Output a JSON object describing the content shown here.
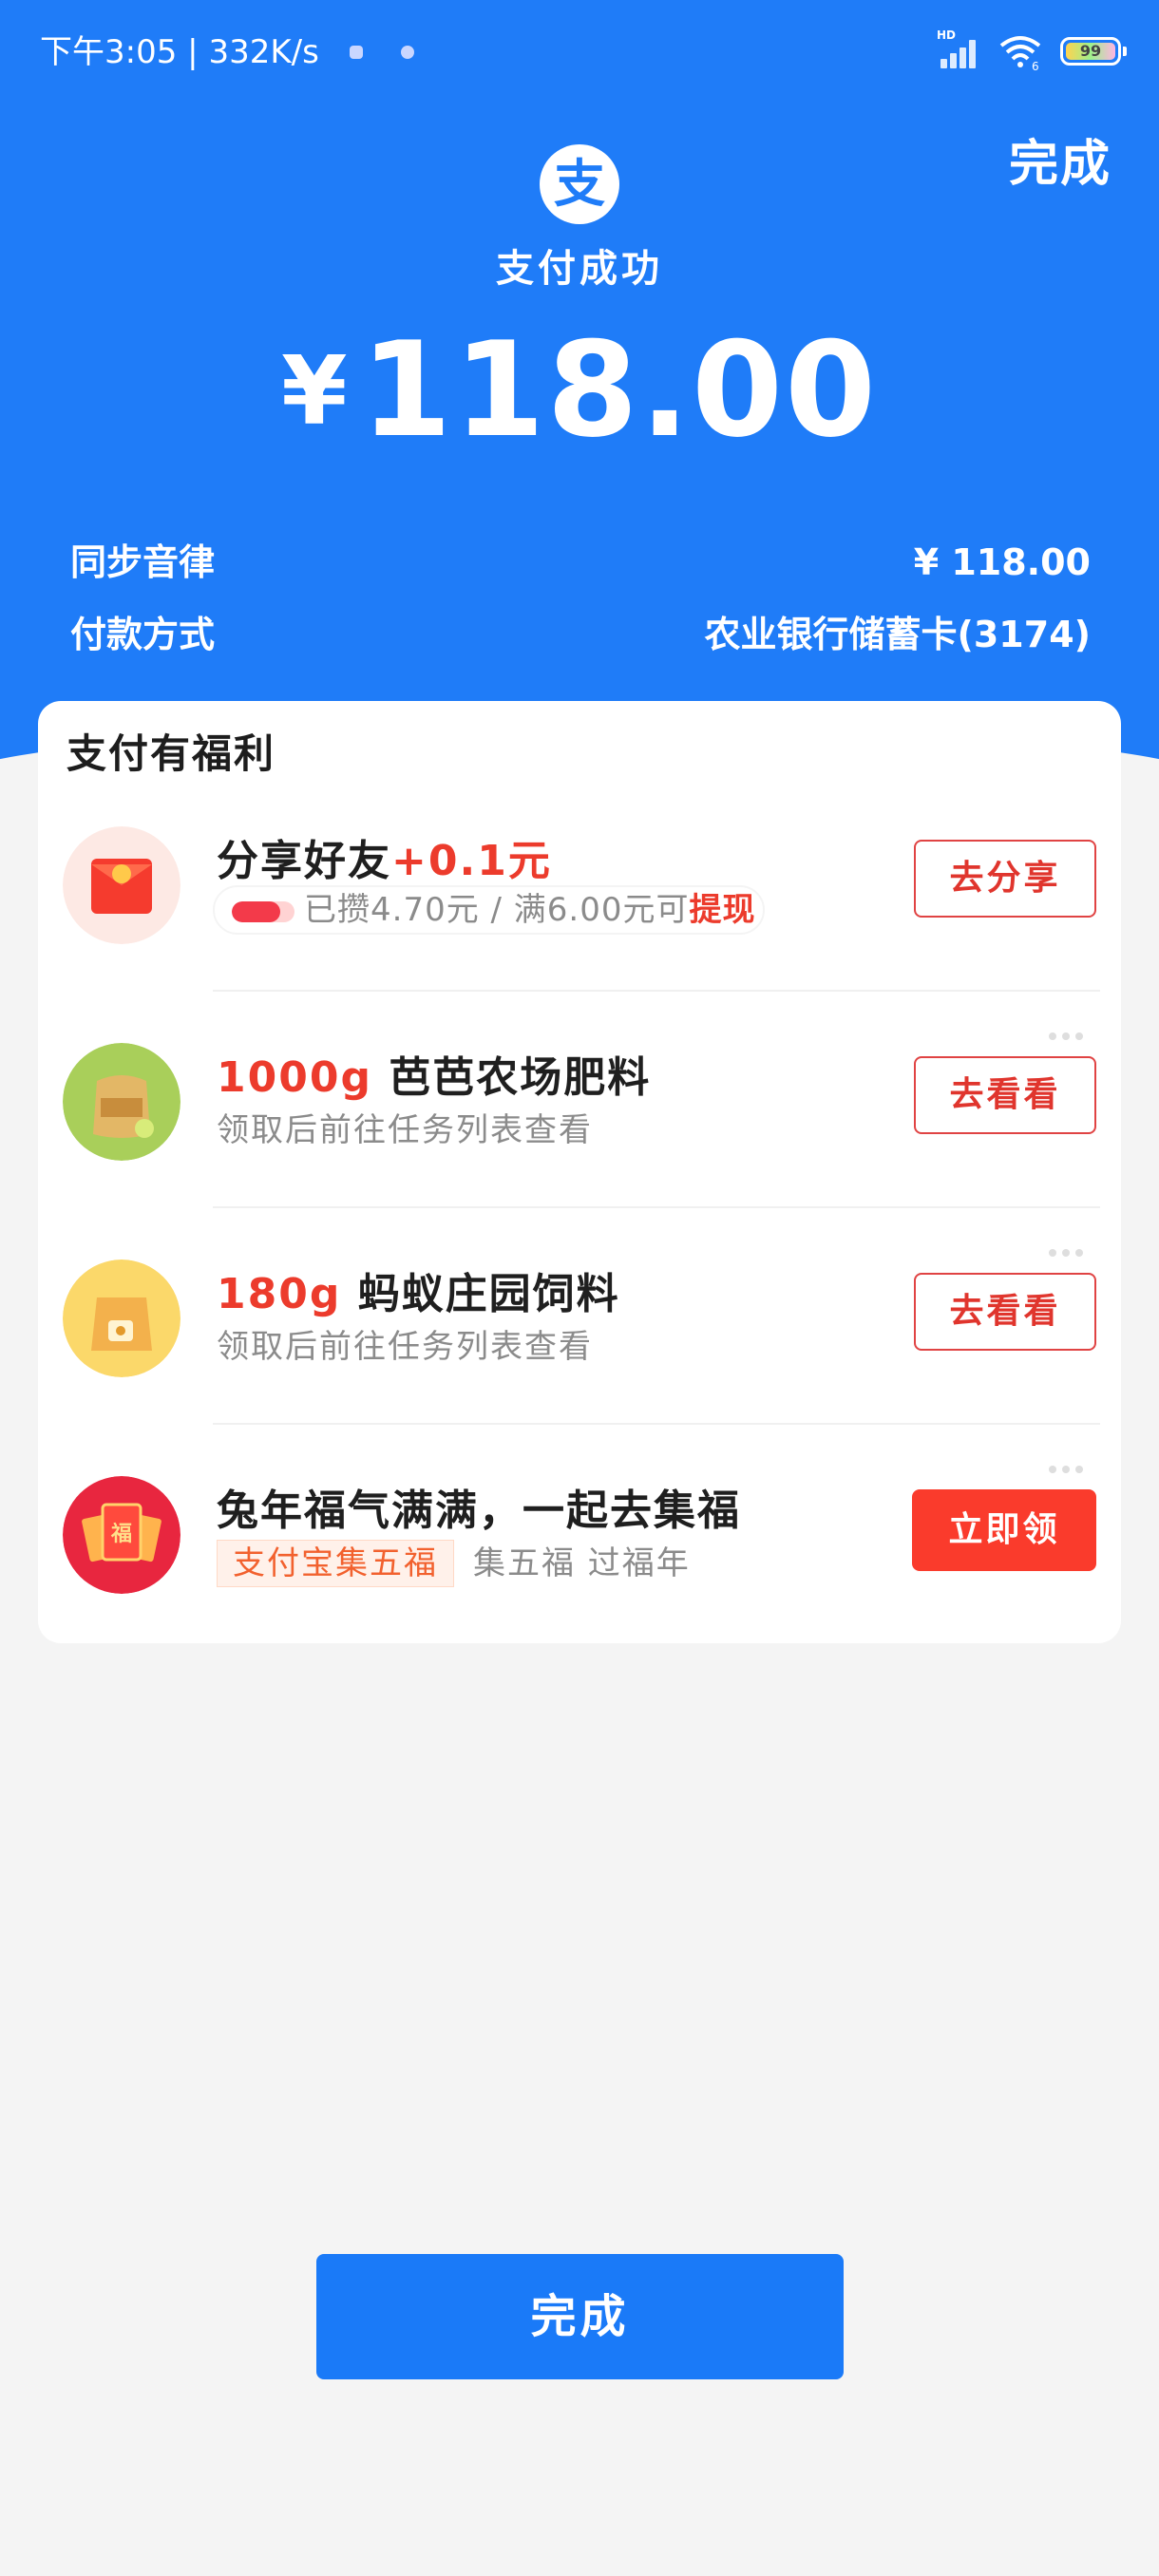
{
  "status_bar": {
    "time": "下午3:05",
    "speed": "332K/s",
    "signal_label": "HD",
    "wifi_label": "6",
    "battery": "99"
  },
  "header": {
    "done_label": "完成",
    "logo_char": "支",
    "status_text": "支付成功",
    "currency": "¥",
    "amount": "118.00"
  },
  "info": [
    {
      "key": "同步音律",
      "value": "¥ 118.00"
    },
    {
      "key": "付款方式",
      "value": "农业银行储蓄卡(3174)"
    }
  ],
  "benefits": {
    "title": "支付有福利",
    "share": {
      "title": "分享好友",
      "bonus": "+0.1元",
      "progress_text": "已攒4.70元 / 满6.00元可",
      "progress_action": "提现",
      "progress_fraction": 0.78,
      "button": "去分享",
      "icon": "red-envelope-icon"
    },
    "farm": {
      "amount": "1000g",
      "title": " 芭芭农场肥料",
      "sub": "领取后前往任务列表查看",
      "button": "去看看",
      "icon": "fertilizer-bag-icon"
    },
    "ant": {
      "amount": "180g",
      "title": " 蚂蚁庄园饲料",
      "sub": " 领取后前往任务列表查看",
      "button": "去看看",
      "icon": "feed-bag-icon"
    },
    "fu": {
      "title": "兔年福气满满，一起去集福",
      "tag": "支付宝集五福",
      "sub": "集五福 过福年",
      "button": "立即领",
      "icon": "fu-card-icon"
    }
  },
  "footer": {
    "done_label": "完成"
  },
  "colors": {
    "brand_blue": "#1f7cf8",
    "accent_red": "#ec3b2c",
    "button_red": "#fa3b2c"
  }
}
